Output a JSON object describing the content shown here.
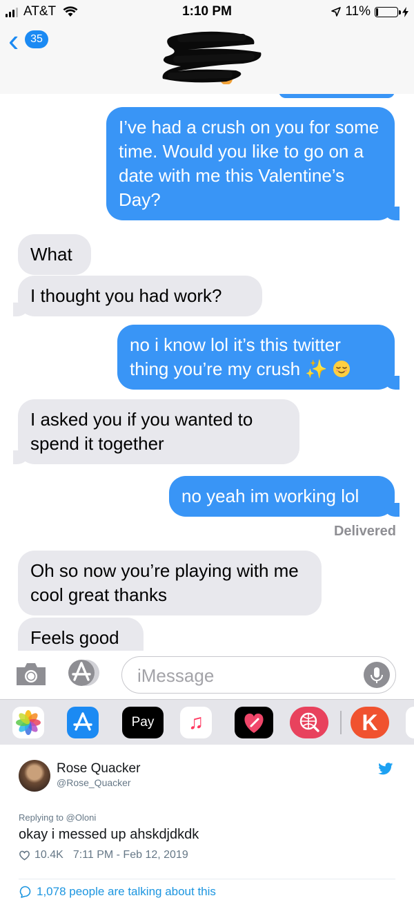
{
  "status_bar": {
    "carrier": "AT&T",
    "time": "1:10 PM",
    "battery_percent": "11%",
    "battery_level": 0.11,
    "icons": [
      "signal-icon",
      "wifi-icon",
      "location-icon",
      "battery-icon",
      "charging-icon"
    ]
  },
  "header": {
    "back_count": "35",
    "contact_name_redacted": true
  },
  "messages": [
    {
      "direction": "sent",
      "text": "I’ve had a crush on you for some time. Would you like to go on a date with me this Valentine’s Day?"
    },
    {
      "direction": "received",
      "text": "What"
    },
    {
      "direction": "received",
      "text": "I thought you had work?"
    },
    {
      "direction": "sent",
      "text": "no i know lol it’s this twitter thing you’re my crush"
    },
    {
      "direction": "received",
      "text": "I asked you if you wanted to spend it together"
    },
    {
      "direction": "sent",
      "text": "no yeah im working lol"
    },
    {
      "direction": "received",
      "text": "Oh so now you’re playing with me cool great thanks"
    },
    {
      "direction": "received",
      "text": "Feels good"
    }
  ],
  "message_emojis": [
    "sparkles-icon",
    "relieved-face-icon"
  ],
  "delivered_label": "Delivered",
  "compose": {
    "placeholder": "iMessage"
  },
  "app_drawer": {
    "apps": [
      "photos-icon",
      "app-store-icon",
      "apple-pay-icon",
      "music-icon",
      "digital-touch-icon",
      "image-search-icon",
      "k-app-icon"
    ],
    "pay_label": "Pay",
    "k_label": "K"
  },
  "tweet": {
    "display_name": "Rose Quacker",
    "handle": "@Rose_Quacker",
    "replying_prefix": "Replying to",
    "replying_to": "@Oloni",
    "text": "okay i messed up ahskdjdkdk",
    "likes": "10.4K",
    "timestamp": "7:11 PM - Feb 12, 2019",
    "talking": "1,078 people are talking about this",
    "colors": {
      "link": "#1b95e0",
      "meta": "#657786"
    }
  },
  "colors": {
    "sent_bubble": "#3995f6",
    "received_bubble": "#e8e8ed",
    "ios_blue": "#1b8af3"
  }
}
